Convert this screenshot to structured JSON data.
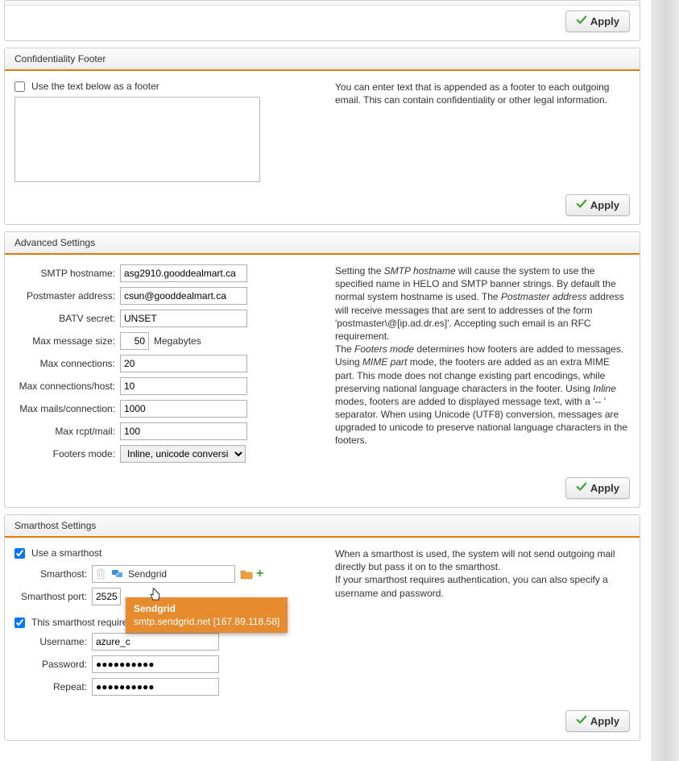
{
  "buttons": {
    "apply": "Apply"
  },
  "top_panel": {
    "apply": "Apply"
  },
  "confidentiality": {
    "title": "Confidentiality Footer",
    "use_footer_label": "Use the text below as a footer",
    "use_footer_checked": false,
    "footer_text": "",
    "help": "You can enter text that is appended as a footer to each outgoing email. This can contain confidentiality or other legal information."
  },
  "advanced": {
    "title": "Advanced Settings",
    "labels": {
      "smtp_hostname": "SMTP hostname:",
      "postmaster": "Postmaster address:",
      "batv": "BATV secret:",
      "max_msg_size": "Max message size:",
      "megabytes": "Megabytes",
      "max_conn": "Max connections:",
      "max_conn_host": "Max connections/host:",
      "max_mails_conn": "Max mails/connection:",
      "max_rcpt": "Max rcpt/mail:",
      "footers_mode": "Footers mode:"
    },
    "values": {
      "smtp_hostname": "asg2910.gooddealmart.ca",
      "postmaster": "csun@gooddealmart.ca",
      "batv": "UNSET",
      "max_msg_size": "50",
      "max_conn": "20",
      "max_conn_host": "10",
      "max_mails_conn": "1000",
      "max_rcpt": "100",
      "footers_mode": "Inline, unicode conversion"
    },
    "help": {
      "p1a": "Setting the ",
      "smtp_hostname_i": "SMTP hostname",
      "p1b": " will cause the system to use the specified name in HELO and SMTP banner strings. By default the normal system hostname is used. The ",
      "postmaster_i": "Postmaster address",
      "p1c": " address will receive messages that are sent to addresses of the form 'postmaster\\@[ip.ad.dr.es]'. Accepting such email is an RFC requirement.",
      "p2a": "The ",
      "footers_mode_i": "Footers mode",
      "p2b": " determines how footers are added to messages. Using ",
      "mime_i": "MIME part",
      "p2c": " mode, the footers are added as an extra MIME part. This mode does not change existing part encodings, while preserving national language characters in the footer. Using ",
      "inline_i": "Inline",
      "p2d": " modes, footers are added to displayed message text, with a '-- ' separator. When using Unicode (UTF8) conversion, messages are upgraded to unicode to preserve national language characters in the footers."
    }
  },
  "smarthost": {
    "title": "Smarthost Settings",
    "use_smarthost_label": "Use a smarthost",
    "use_smarthost_checked": true,
    "smarthost_label": "Smarthost:",
    "smarthost_value": "Sendgrid",
    "port_label": "Smarthost port:",
    "port_value": "2525",
    "auth_label": "This smarthost requires authentication",
    "auth_checked": true,
    "username_label": "Username:",
    "username_value": "azure_c",
    "password_label": "Password:",
    "password_value": "●●●●●●●●●●",
    "repeat_label": "Repeat:",
    "repeat_value": "●●●●●●●●●●",
    "help": {
      "l1": "When a smarthost is used, the system will not send outgoing mail directly but pass it on to the smarthost.",
      "l2": "If your smarthost requires authentication, you can also specify a username and password."
    },
    "tooltip": {
      "title": "Sendgrid",
      "detail": "smtp.sendgrid.net [167.89.118.58]"
    }
  }
}
